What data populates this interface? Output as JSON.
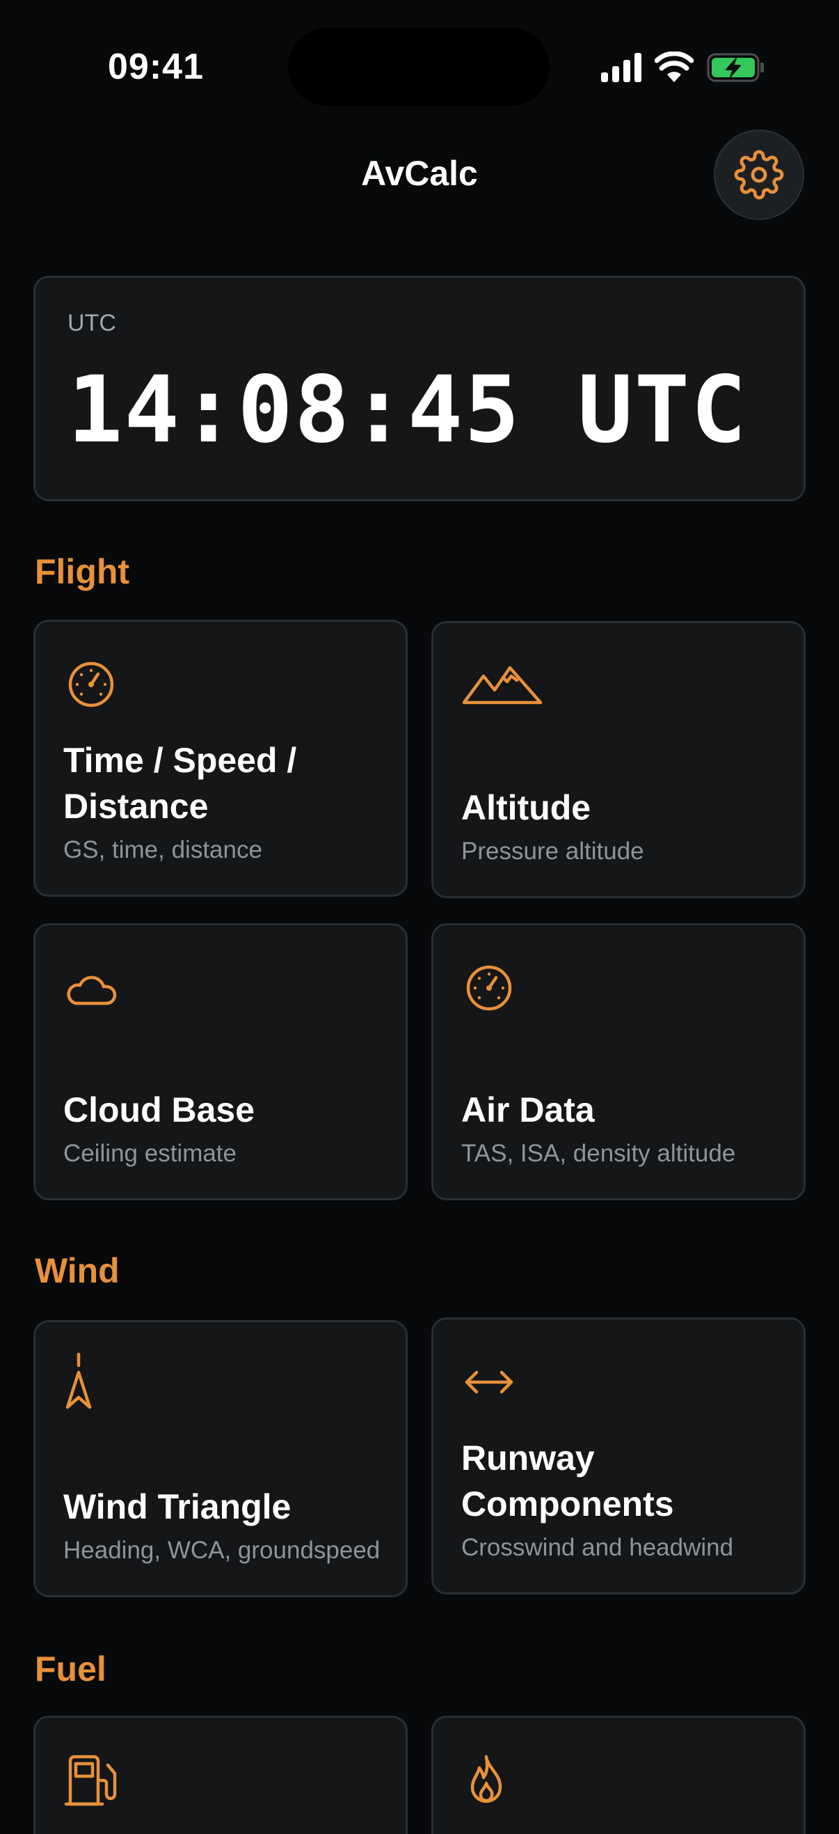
{
  "status_bar": {
    "time": "09:41"
  },
  "header": {
    "title": "AvCalc"
  },
  "utc_card": {
    "label": "UTC",
    "value": "14:08:45 UTC"
  },
  "sections": {
    "flight": {
      "title": "Flight",
      "cards": [
        {
          "title": "Time / Speed / Distance",
          "subtitle": "GS, time, distance",
          "icon": "gauge-icon"
        },
        {
          "title": "Altitude",
          "subtitle": "Pressure altitude",
          "icon": "mountains-icon"
        },
        {
          "title": "Cloud Base",
          "subtitle": "Ceiling estimate",
          "icon": "cloud-icon"
        },
        {
          "title": "Air Data",
          "subtitle": "TAS, ISA, density altitude",
          "icon": "gauge-icon"
        }
      ]
    },
    "wind": {
      "title": "Wind",
      "cards": [
        {
          "title": "Wind Triangle",
          "subtitle": "Heading, WCA, groundspeed",
          "icon": "navigation-arrow-icon"
        },
        {
          "title": "Runway Components",
          "subtitle": "Crosswind and headwind",
          "icon": "horizontal-arrows-icon"
        }
      ]
    },
    "fuel": {
      "title": "Fuel",
      "cards": [
        {
          "title": "",
          "subtitle": "",
          "icon": "fuel-pump-icon"
        },
        {
          "title": "",
          "subtitle": "",
          "icon": "flame-icon"
        }
      ]
    }
  },
  "colors": {
    "accent": "#e8913a",
    "background": "#07090b",
    "card": "#141618",
    "card_border": "#2a2e32",
    "battery": "#34c759"
  }
}
